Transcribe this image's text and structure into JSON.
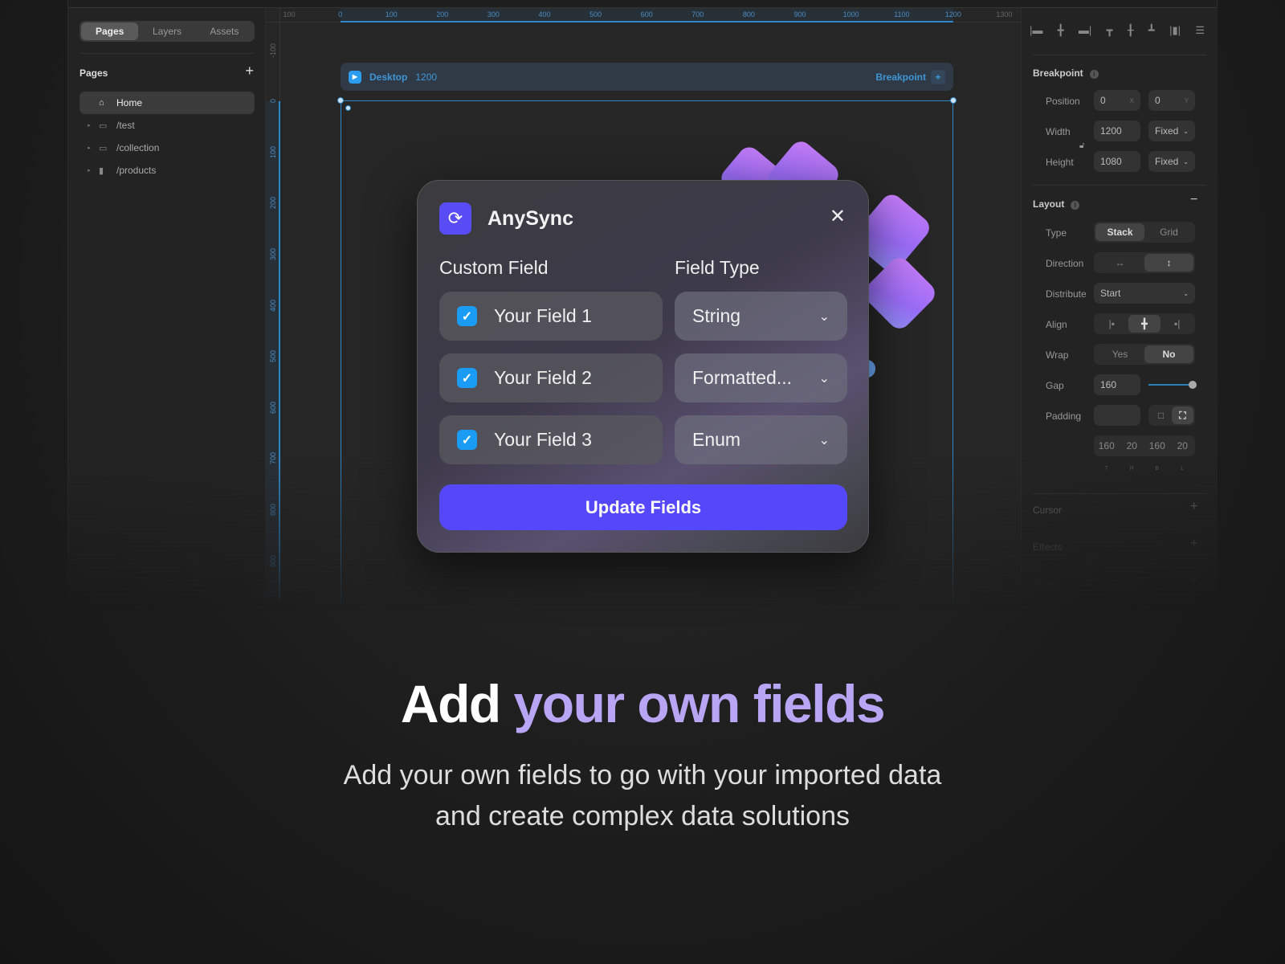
{
  "left_panel": {
    "tabs": [
      "Pages",
      "Layers",
      "Assets"
    ],
    "section_title": "Pages",
    "add_icon": "plus-icon",
    "pages": [
      {
        "label": "Home",
        "icon": "home-icon"
      },
      {
        "label": "/test",
        "icon": "folder-icon"
      },
      {
        "label": "/collection",
        "icon": "folder-icon"
      },
      {
        "label": "/products",
        "icon": "file-icon"
      }
    ]
  },
  "canvas": {
    "h_ruler": [
      "100",
      "0",
      "100",
      "200",
      "300",
      "400",
      "500",
      "600",
      "700",
      "800",
      "900",
      "1000",
      "1100",
      "1200",
      "1300"
    ],
    "v_ruler": [
      "-100",
      "0",
      "100",
      "200",
      "300",
      "400",
      "500",
      "600",
      "700",
      "800",
      "900"
    ],
    "breakpoint_bar": {
      "name": "Desktop",
      "width": "1200",
      "action": "Breakpoint"
    }
  },
  "dialog": {
    "title": "AnySync",
    "col_custom": "Custom Field",
    "col_type": "Field Type",
    "rows": [
      {
        "field": "Your Field 1",
        "type": "String",
        "checked": true
      },
      {
        "field": "Your Field 2",
        "type": "Formatted...",
        "checked": true
      },
      {
        "field": "Your Field 3",
        "type": "Enum",
        "checked": true
      }
    ],
    "button": "Update Fields",
    "accent": "#5548fa",
    "checkbox_color": "#1a9cf5"
  },
  "right_panel": {
    "breakpoint": {
      "title": "Breakpoint",
      "position_label": "Position",
      "x": "0",
      "x_unit": "X",
      "y": "0",
      "y_unit": "Y",
      "width_label": "Width",
      "width": "1200",
      "width_mode": "Fixed",
      "height_label": "Height",
      "height": "1080",
      "height_mode": "Fixed"
    },
    "layout": {
      "title": "Layout",
      "type_label": "Type",
      "type_options": [
        "Stack",
        "Grid"
      ],
      "direction_label": "Direction",
      "distribute_label": "Distribute",
      "distribute": "Start",
      "align_label": "Align",
      "wrap_label": "Wrap",
      "wrap_options": [
        "Yes",
        "No"
      ],
      "gap_label": "Gap",
      "gap": "160",
      "gap_slider": 1.0,
      "padding_label": "Padding",
      "padding": [
        "160",
        "20",
        "160",
        "20"
      ],
      "padding_sides": [
        "T",
        "R",
        "B",
        "L"
      ]
    },
    "sections": [
      "Cursor",
      "Effects",
      "Styles"
    ]
  },
  "hero": {
    "headline_plain": "Add",
    "headline_highlight": "your own fields",
    "subtitle_line1": "Add your own fields to go with your imported data",
    "subtitle_line2": "and create complex data solutions",
    "highlight_color": "#b8a6f5"
  }
}
